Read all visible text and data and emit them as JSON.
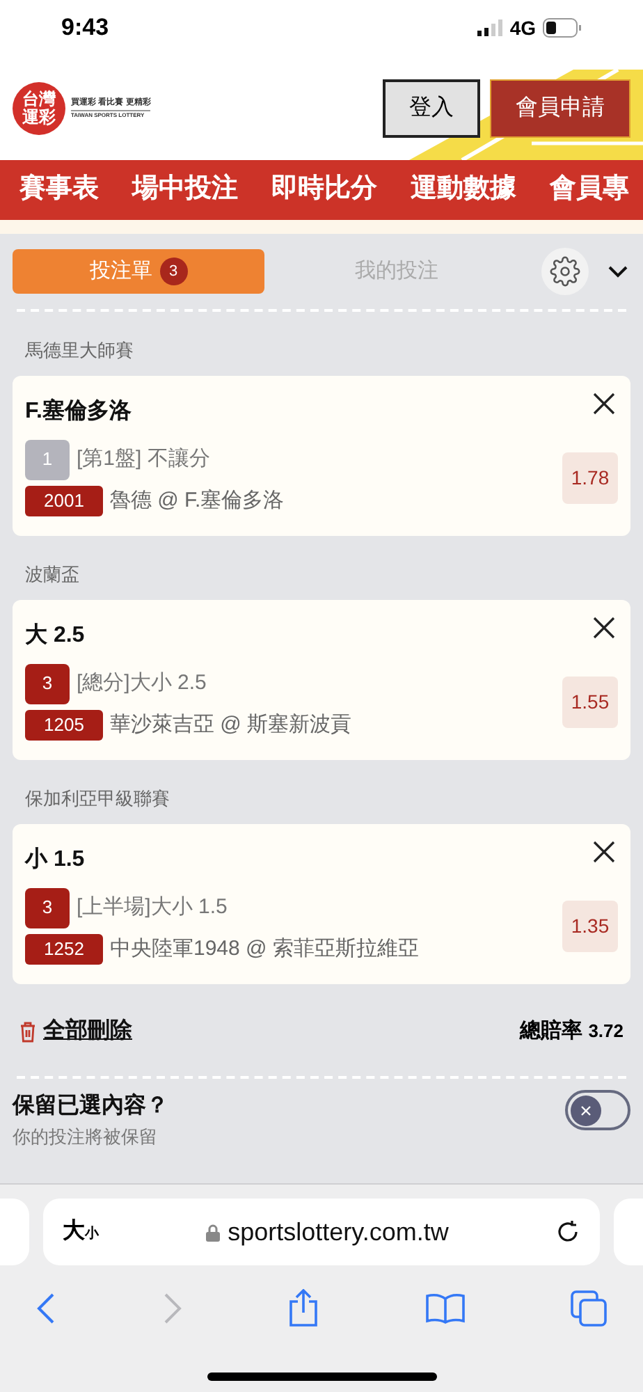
{
  "status_bar": {
    "time": "9:43",
    "network": "4G"
  },
  "header": {
    "logo_mark": "台灣運彩",
    "slogan": "買運彩 看比賽 更精彩",
    "logo_subtitle": "TAIWAN SPORTS LOTTERY",
    "login": "登入",
    "register": "會員申請"
  },
  "nav": [
    {
      "label": "賽事表"
    },
    {
      "label": "場中投注"
    },
    {
      "label": "即時比分"
    },
    {
      "label": "運動數據"
    },
    {
      "label": "會員專"
    }
  ],
  "tabs": [
    {
      "label": "投注單",
      "badge": "3",
      "selected": true
    },
    {
      "label": "我的投注",
      "selected": false
    }
  ],
  "bets": [
    {
      "league": "馬德里大師賽",
      "selection": "F.塞倫多洛",
      "leg": "1",
      "leg_active": false,
      "market": "[第1盤] 不讓分",
      "code": "2001",
      "match": "魯德 @ F.塞倫多洛",
      "odds": "1.78"
    },
    {
      "league": "波蘭盃",
      "selection": "大 2.5",
      "leg": "3",
      "leg_active": true,
      "market": "[總分]大小 2.5",
      "code": "1205",
      "match": "華沙萊吉亞 @ 斯塞新波貢",
      "odds": "1.55"
    },
    {
      "league": "保加利亞甲級聯賽",
      "selection": "小 1.5",
      "leg": "3",
      "leg_active": true,
      "market": "[上半場]大小 1.5",
      "code": "1252",
      "match": "中央陸軍1948 @ 索菲亞斯拉維亞",
      "odds": "1.35"
    }
  ],
  "delete_all": "全部刪除",
  "total_odds_label": "總賠率",
  "total_odds": "3.72",
  "keep": {
    "title": "保留已選內容？",
    "subtitle": "你的投注將被保留",
    "on": false
  },
  "browser": {
    "text_size": "大",
    "text_size_small": "小",
    "url": "sportslottery.com.tw"
  }
}
